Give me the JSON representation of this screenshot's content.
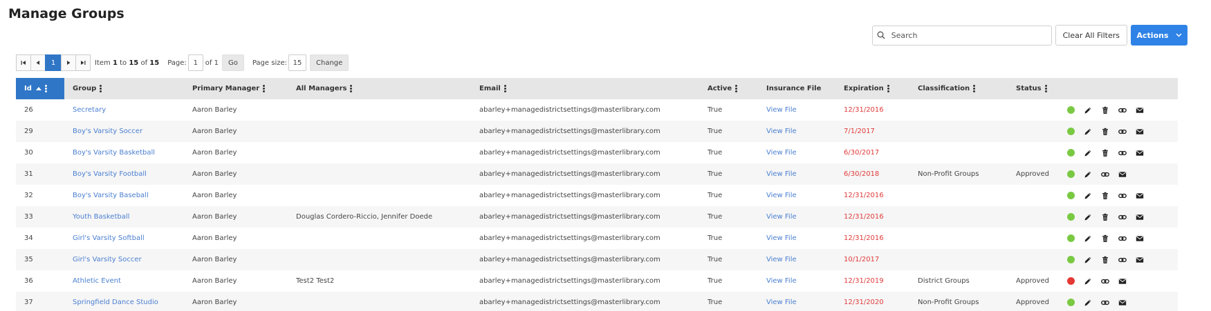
{
  "page": {
    "title": "Manage Groups"
  },
  "toolbar": {
    "search_placeholder": "Search",
    "clear_filters_label": "Clear All Filters",
    "actions_label": "Actions"
  },
  "pager": {
    "current_page": "1",
    "item_label": "Item",
    "range_start": "1",
    "to_label": "to",
    "range_end": "15",
    "of_label": "of",
    "total": "15",
    "page_label": "Page:",
    "page_input": "1",
    "page_of": "of 1",
    "go_label": "Go",
    "page_size_label": "Page size:",
    "page_size_value": "15",
    "change_label": "Change"
  },
  "columns": {
    "id": "Id",
    "group": "Group",
    "primary_manager": "Primary Manager",
    "all_managers": "All Managers",
    "email": "Email",
    "active": "Active",
    "insurance_file": "Insurance File",
    "expiration": "Expiration",
    "classification": "Classification",
    "status": "Status"
  },
  "colors": {
    "accent": "#2f76c7",
    "link": "#4a7fd0",
    "expired": "#e03a3a",
    "active_dot": "#7ac943",
    "inactive_dot": "#e53935"
  },
  "rows": [
    {
      "id": "26",
      "group": "Secretary",
      "primary_manager": "Aaron Barley",
      "all_managers": "",
      "email": "abarley+managedistrictsettings@masterlibrary.com",
      "active": "True",
      "insurance_file": "View File",
      "expiration": "12/31/2016",
      "classification": "",
      "status": "",
      "status_dot": "green",
      "deletable": true
    },
    {
      "id": "29",
      "group": "Boy's Varsity Soccer",
      "primary_manager": "Aaron Barley",
      "all_managers": "",
      "email": "abarley+managedistrictsettings@masterlibrary.com",
      "active": "True",
      "insurance_file": "View File",
      "expiration": "7/1/2017",
      "classification": "",
      "status": "",
      "status_dot": "green",
      "deletable": true
    },
    {
      "id": "30",
      "group": "Boy's Varsity Basketball",
      "primary_manager": "Aaron Barley",
      "all_managers": "",
      "email": "abarley+managedistrictsettings@masterlibrary.com",
      "active": "True",
      "insurance_file": "View File",
      "expiration": "6/30/2017",
      "classification": "",
      "status": "",
      "status_dot": "green",
      "deletable": true
    },
    {
      "id": "31",
      "group": "Boy's Varsity Football",
      "primary_manager": "Aaron Barley",
      "all_managers": "",
      "email": "abarley+managedistrictsettings@masterlibrary.com",
      "active": "True",
      "insurance_file": "View File",
      "expiration": "6/30/2018",
      "classification": "Non-Profit Groups",
      "status": "Approved",
      "status_dot": "green",
      "deletable": false
    },
    {
      "id": "32",
      "group": "Boy's Varsity Baseball",
      "primary_manager": "Aaron Barley",
      "all_managers": "",
      "email": "abarley+managedistrictsettings@masterlibrary.com",
      "active": "True",
      "insurance_file": "View File",
      "expiration": "12/31/2016",
      "classification": "",
      "status": "",
      "status_dot": "green",
      "deletable": true
    },
    {
      "id": "33",
      "group": "Youth Basketball",
      "primary_manager": "Aaron Barley",
      "all_managers": "Douglas Cordero-Riccio, Jennifer Doede",
      "email": "abarley+managedistrictsettings@masterlibrary.com",
      "active": "True",
      "insurance_file": "View File",
      "expiration": "12/31/2016",
      "classification": "",
      "status": "",
      "status_dot": "green",
      "deletable": true
    },
    {
      "id": "34",
      "group": "Girl's Varsity Softball",
      "primary_manager": "Aaron Barley",
      "all_managers": "",
      "email": "abarley+managedistrictsettings@masterlibrary.com",
      "active": "True",
      "insurance_file": "View File",
      "expiration": "12/31/2016",
      "classification": "",
      "status": "",
      "status_dot": "green",
      "deletable": true
    },
    {
      "id": "35",
      "group": "Girl's Varsity Soccer",
      "primary_manager": "Aaron Barley",
      "all_managers": "",
      "email": "abarley+managedistrictsettings@masterlibrary.com",
      "active": "True",
      "insurance_file": "View File",
      "expiration": "10/1/2017",
      "classification": "",
      "status": "",
      "status_dot": "green",
      "deletable": true
    },
    {
      "id": "36",
      "group": "Athletic Event",
      "primary_manager": "Aaron Barley",
      "all_managers": "Test2 Test2",
      "email": "abarley+managedistrictsettings@masterlibrary.com",
      "active": "True",
      "insurance_file": "View File",
      "expiration": "12/31/2019",
      "classification": "District Groups",
      "status": "Approved",
      "status_dot": "red",
      "deletable": false
    },
    {
      "id": "37",
      "group": "Springfield Dance Studio",
      "primary_manager": "Aaron Barley",
      "all_managers": "",
      "email": "abarley+managedistrictsettings@masterlibrary.com",
      "active": "True",
      "insurance_file": "View File",
      "expiration": "12/31/2020",
      "classification": "Non-Profit Groups",
      "status": "Approved",
      "status_dot": "green",
      "deletable": false
    }
  ]
}
